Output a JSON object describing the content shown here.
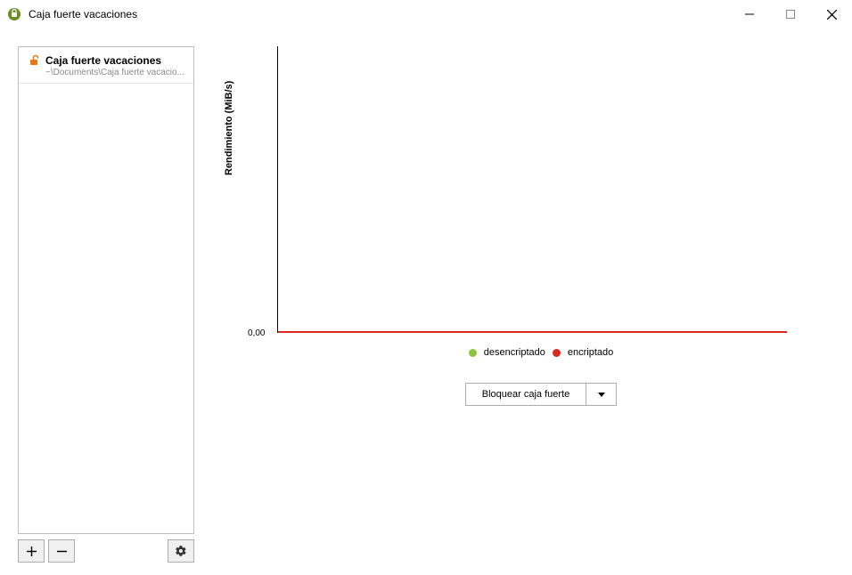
{
  "window": {
    "title": "Caja fuerte vacaciones"
  },
  "sidebar": {
    "vaults": [
      {
        "name": "Caja fuerte vacaciones",
        "path": "~\\Documents\\Caja fuerte vacacio..."
      }
    ]
  },
  "buttons": {
    "lock": "Bloquear caja fuerte"
  },
  "legend": {
    "decrypted": "desencriptado",
    "encrypted": "encriptado"
  },
  "chart_data": {
    "type": "line",
    "title": "",
    "xlabel": "",
    "ylabel": "Rendimiento (MiB/s)",
    "yticks": [
      "0,00"
    ],
    "ylim": [
      0,
      0
    ],
    "series": [
      {
        "name": "desencriptado",
        "color": "#8cc63f",
        "values": []
      },
      {
        "name": "encriptado",
        "color": "#d9281f",
        "values": [
          0
        ]
      }
    ]
  }
}
